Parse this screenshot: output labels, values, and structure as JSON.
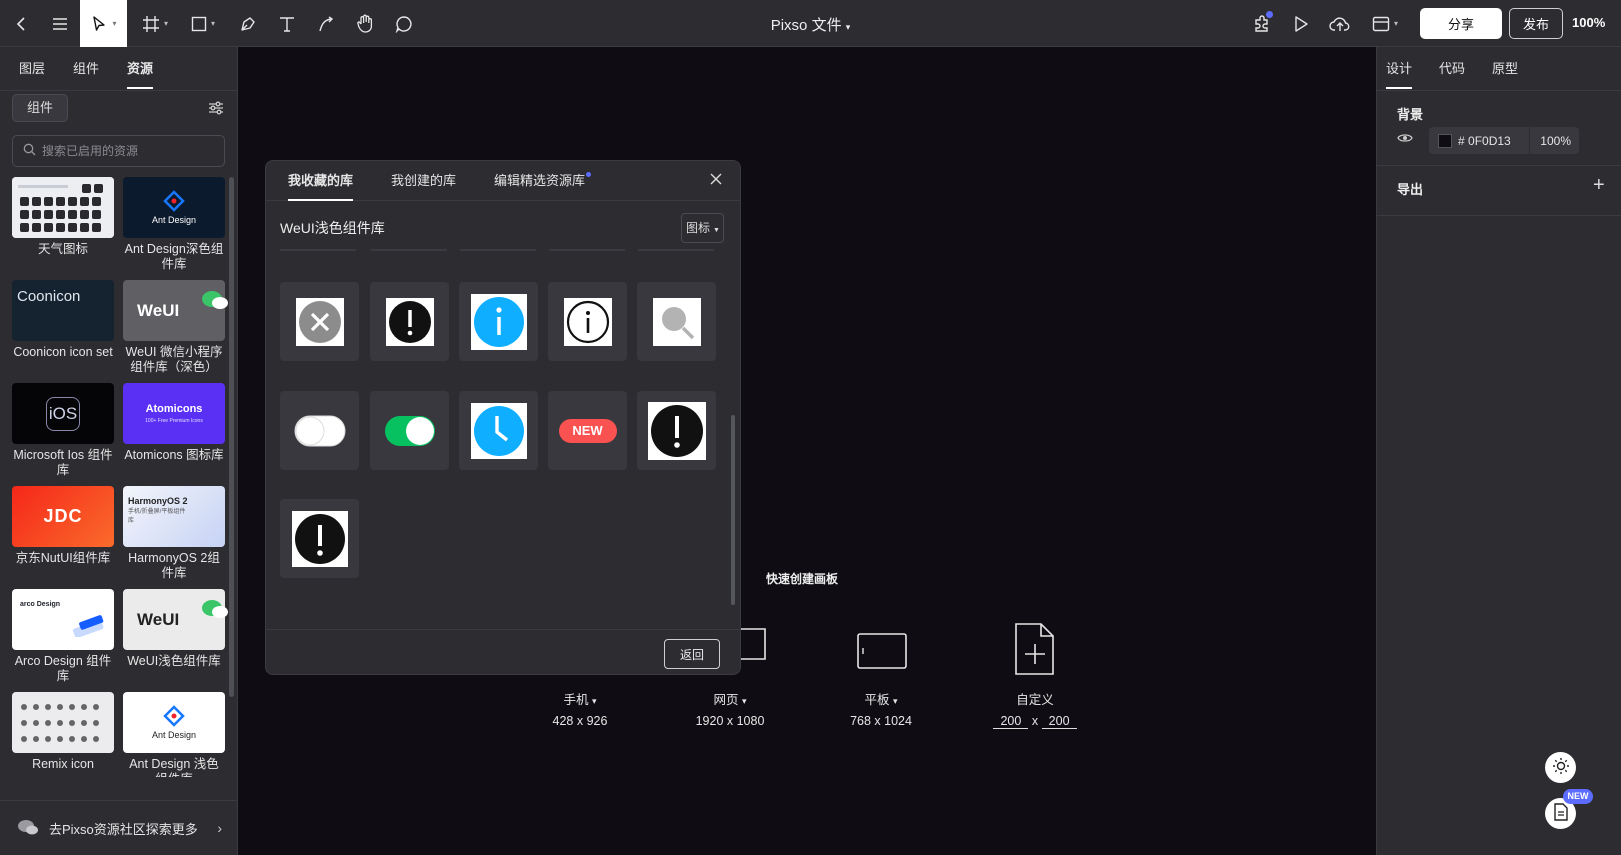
{
  "toolbar": {
    "file_title": "Pixso 文件",
    "share_label": "分享",
    "publish_label": "发布",
    "zoom": "100%",
    "tools": [
      "back-icon",
      "menu-icon",
      "move-tool-icon",
      "frame-tool-icon",
      "shape-tool-icon",
      "pen-tool-icon",
      "text-tool-icon",
      "path-tool-icon",
      "hand-tool-icon",
      "comment-tool-icon"
    ],
    "right_icons": [
      "plugin-icon",
      "play-icon",
      "upload-icon",
      "layout-icon"
    ],
    "accent": "#5b6cff"
  },
  "left_panel": {
    "tabs": [
      "图层",
      "组件",
      "资源"
    ],
    "active_tab": "资源",
    "filter_label": "组件",
    "search_placeholder": "搜索已启用的资源",
    "libraries": [
      {
        "name": "天气图标"
      },
      {
        "name": "Ant Design深色组件库",
        "thumb_text": "Ant Design"
      },
      {
        "name": "Coonicon icon set",
        "thumb_text": "Coonicon"
      },
      {
        "name": "WeUI 微信小程序组件库（深色）",
        "thumb_text": "WeUI"
      },
      {
        "name": "Microsoft Ios 组件库",
        "thumb_text": "iOS"
      },
      {
        "name": "Atomicons 图标库",
        "thumb_text": "Atomicons",
        "thumb_sub": "100+ Free Premium Icons"
      },
      {
        "name": "京东NutUI组件库",
        "thumb_text": "JDC"
      },
      {
        "name": "HarmonyOS 2组件库",
        "thumb_text": "HarmonyOS 2",
        "thumb_sub": "手机/折叠屏/平板组件库"
      },
      {
        "name": "Arco Design 组件库",
        "thumb_text": "arco Design"
      },
      {
        "name": "WeUI浅色组件库",
        "thumb_text": "WeUI"
      },
      {
        "name": "Remix icon"
      },
      {
        "name": "Ant Design 浅色组件库",
        "thumb_text": "Ant Design"
      }
    ],
    "footer_text": "去Pixso资源社区探索更多"
  },
  "right_panel": {
    "tabs": [
      "设计",
      "代码",
      "原型"
    ],
    "active_tab": "设计",
    "background_title": "背景",
    "background_hex": "0F0D13",
    "background_opacity": "100%",
    "export_title": "导出",
    "new_badge": "NEW"
  },
  "canvas": {
    "quick_create_title": "快速创建画板",
    "presets": [
      {
        "name": "手机",
        "size": "428 x 926"
      },
      {
        "name": "网页",
        "size": "1920 x 1080"
      },
      {
        "name": "平板",
        "size": "768 x 1024"
      },
      {
        "name": "自定义",
        "w": "200",
        "x": "x",
        "h": "200"
      }
    ]
  },
  "modal": {
    "tabs": [
      "我收藏的库",
      "我创建的库",
      "编辑精选资源库"
    ],
    "active_tab": "我收藏的库",
    "library_title": "WeUI浅色组件库",
    "category": "图标",
    "back_label": "返回",
    "new_tag": "NEW",
    "icons": [
      "clear-circle-icon",
      "warn-filled-icon",
      "info-filled-icon",
      "info-outline-icon",
      "search-icon",
      "switch-off-icon",
      "switch-on-icon",
      "waiting-icon",
      "new-tag-icon",
      "warn-circle-icon",
      "warn-circle-icon"
    ]
  }
}
